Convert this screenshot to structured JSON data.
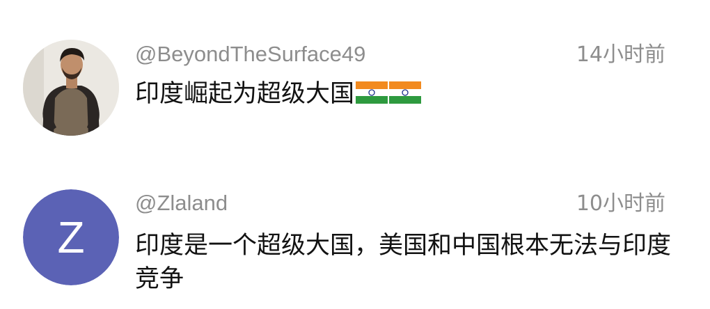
{
  "comments": [
    {
      "username": "@BeyondTheSurface49",
      "timestamp": "14小时前",
      "text": "印度崛起为超级大国",
      "emoji": [
        "india-flag-emoji",
        "india-flag-emoji"
      ]
    },
    {
      "username": "@Zlaland",
      "timestamp": "10小时前",
      "avatar_letter": "Z",
      "avatar_color": "#5b62b5",
      "text": "印度是一个超级大国，美国和中国根本无法与印度竞争"
    }
  ],
  "colors": {
    "meta_text": "#8d8d8d",
    "body_text": "#121212",
    "background": "#ffffff"
  }
}
